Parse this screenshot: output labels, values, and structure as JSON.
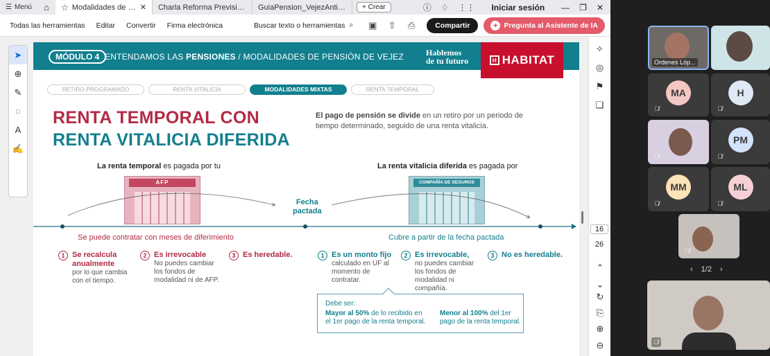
{
  "browser": {
    "menu_label": "Menú",
    "tabs": [
      {
        "label": "Modalidades de pen..."
      },
      {
        "label": "Charla Reforma Previsional..."
      },
      {
        "label": "GuiaPension_VejezAnticipa..."
      }
    ],
    "new_tab_label": "Crear",
    "signin_label": "Iniciar sesión"
  },
  "toolbar": {
    "items": [
      "Todas las herramientas",
      "Editar",
      "Convertir",
      "Firma electrónica"
    ],
    "search_label": "Buscar texto o herramientas",
    "share_label": "Compartir",
    "ai_label": "Pregunta al Asistente de IA"
  },
  "viewer": {
    "page_current": "16",
    "page_total": "26",
    "page_indicator": "1/2"
  },
  "slide": {
    "module_pill": "MÓDULO 4",
    "banner_prefix": "ENTENDAMOS LAS ",
    "banner_bold": "PENSIONES",
    "banner_suffix": " / MODALIDADES DE PENSIÓN DE VEJEZ",
    "slogan_line1": "Hablemos",
    "slogan_line2": "de tu futuro",
    "logo_text": "HABITAT",
    "steps": [
      "RETIRO PROGRAMADO",
      "RENTA VITALICIA",
      "MODALIDADES MIXTAS",
      "RENTA TEMPORAL"
    ],
    "title_line1": "RENTA TEMPORAL CON",
    "title_line2": "RENTA VITALICIA DIFERIDA",
    "intro_bold": "El pago de pensión se divide",
    "intro_rest": " en un retiro por un periodo de tiempo determinado, seguido de una renta vitalicia.",
    "left_paid_bold": "La renta temporal",
    "left_paid_rest": " es pagada por tu",
    "right_paid_bold": "La renta vitalicia diferida",
    "right_paid_rest": " es pagada por",
    "afp_sign": "AFP",
    "cia_sign": "COMPAÑÍA DE SEGUROS",
    "fecha_line1": "Fecha",
    "fecha_line2": "pactada",
    "left_sub": "Se puede contratar con meses de diferimiento",
    "right_sub": "Cubre a partir de la fecha pactada",
    "left_features": [
      {
        "n": "1",
        "title": "Se recalcula anualmente",
        "desc": "por lo que cambia con el tiempo."
      },
      {
        "n": "2",
        "title": "Es irrevocable",
        "desc": "No puedes cambiar los fondos de modalidad ni de AFP."
      },
      {
        "n": "3",
        "title": "Es heredable.",
        "desc": ""
      }
    ],
    "right_features": [
      {
        "n": "1",
        "title": "Es un monto fijo",
        "desc": "calculado en UF al momento de contratar."
      },
      {
        "n": "2",
        "title": "Es irrevocable,",
        "desc": "no puedes cambiar los fondos de modalidad ni compañía."
      },
      {
        "n": "3",
        "title": "No es heredable.",
        "desc": ""
      }
    ],
    "callout": {
      "title": "Debe ser:",
      "left_bold": "Mayor al 50%",
      "left_rest": " de lo recibido en el 1er pago de la renta temporal.",
      "right_bold": "Menor al 100%",
      "right_rest": " del 1er pago de la renta temporal."
    }
  },
  "meeting": {
    "participants": [
      {
        "initials": "",
        "name": "Ordenes Lóp...",
        "type": "camera"
      },
      {
        "initials": "",
        "name": "",
        "type": "camera"
      },
      {
        "initials": "MA",
        "name": "",
        "type": "avatar",
        "color": "#f4c7c3"
      },
      {
        "initials": "H",
        "name": "",
        "type": "avatar",
        "color": "#dfe8f5"
      },
      {
        "initials": "",
        "name": "",
        "type": "camera"
      },
      {
        "initials": "PM",
        "name": "",
        "type": "avatar",
        "color": "#d2e3fc"
      },
      {
        "initials": "MM",
        "name": "",
        "type": "avatar",
        "color": "#fde3b8"
      },
      {
        "initials": "ML",
        "name": "",
        "type": "avatar",
        "color": "#f6d0d5"
      },
      {
        "initials": "",
        "name": "",
        "type": "camera"
      },
      {
        "initials": "",
        "name": "",
        "type": "camera"
      }
    ]
  }
}
